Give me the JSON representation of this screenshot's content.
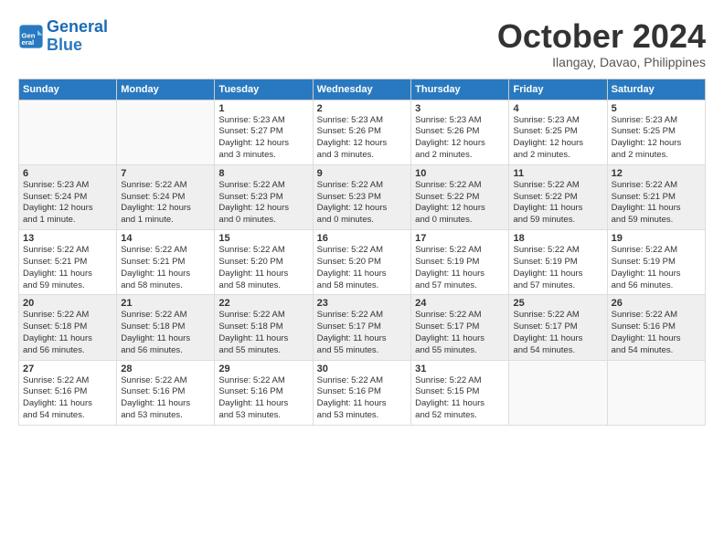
{
  "logo": {
    "text_general": "General",
    "text_blue": "Blue"
  },
  "header": {
    "month": "October 2024",
    "location": "Ilangay, Davao, Philippines"
  },
  "weekdays": [
    "Sunday",
    "Monday",
    "Tuesday",
    "Wednesday",
    "Thursday",
    "Friday",
    "Saturday"
  ],
  "weeks": [
    {
      "days": [
        {
          "num": "",
          "info": ""
        },
        {
          "num": "",
          "info": ""
        },
        {
          "num": "1",
          "info": "Sunrise: 5:23 AM\nSunset: 5:27 PM\nDaylight: 12 hours\nand 3 minutes."
        },
        {
          "num": "2",
          "info": "Sunrise: 5:23 AM\nSunset: 5:26 PM\nDaylight: 12 hours\nand 3 minutes."
        },
        {
          "num": "3",
          "info": "Sunrise: 5:23 AM\nSunset: 5:26 PM\nDaylight: 12 hours\nand 2 minutes."
        },
        {
          "num": "4",
          "info": "Sunrise: 5:23 AM\nSunset: 5:25 PM\nDaylight: 12 hours\nand 2 minutes."
        },
        {
          "num": "5",
          "info": "Sunrise: 5:23 AM\nSunset: 5:25 PM\nDaylight: 12 hours\nand 2 minutes."
        }
      ]
    },
    {
      "days": [
        {
          "num": "6",
          "info": "Sunrise: 5:23 AM\nSunset: 5:24 PM\nDaylight: 12 hours\nand 1 minute."
        },
        {
          "num": "7",
          "info": "Sunrise: 5:22 AM\nSunset: 5:24 PM\nDaylight: 12 hours\nand 1 minute."
        },
        {
          "num": "8",
          "info": "Sunrise: 5:22 AM\nSunset: 5:23 PM\nDaylight: 12 hours\nand 0 minutes."
        },
        {
          "num": "9",
          "info": "Sunrise: 5:22 AM\nSunset: 5:23 PM\nDaylight: 12 hours\nand 0 minutes."
        },
        {
          "num": "10",
          "info": "Sunrise: 5:22 AM\nSunset: 5:22 PM\nDaylight: 12 hours\nand 0 minutes."
        },
        {
          "num": "11",
          "info": "Sunrise: 5:22 AM\nSunset: 5:22 PM\nDaylight: 11 hours\nand 59 minutes."
        },
        {
          "num": "12",
          "info": "Sunrise: 5:22 AM\nSunset: 5:21 PM\nDaylight: 11 hours\nand 59 minutes."
        }
      ]
    },
    {
      "days": [
        {
          "num": "13",
          "info": "Sunrise: 5:22 AM\nSunset: 5:21 PM\nDaylight: 11 hours\nand 59 minutes."
        },
        {
          "num": "14",
          "info": "Sunrise: 5:22 AM\nSunset: 5:21 PM\nDaylight: 11 hours\nand 58 minutes."
        },
        {
          "num": "15",
          "info": "Sunrise: 5:22 AM\nSunset: 5:20 PM\nDaylight: 11 hours\nand 58 minutes."
        },
        {
          "num": "16",
          "info": "Sunrise: 5:22 AM\nSunset: 5:20 PM\nDaylight: 11 hours\nand 58 minutes."
        },
        {
          "num": "17",
          "info": "Sunrise: 5:22 AM\nSunset: 5:19 PM\nDaylight: 11 hours\nand 57 minutes."
        },
        {
          "num": "18",
          "info": "Sunrise: 5:22 AM\nSunset: 5:19 PM\nDaylight: 11 hours\nand 57 minutes."
        },
        {
          "num": "19",
          "info": "Sunrise: 5:22 AM\nSunset: 5:19 PM\nDaylight: 11 hours\nand 56 minutes."
        }
      ]
    },
    {
      "days": [
        {
          "num": "20",
          "info": "Sunrise: 5:22 AM\nSunset: 5:18 PM\nDaylight: 11 hours\nand 56 minutes."
        },
        {
          "num": "21",
          "info": "Sunrise: 5:22 AM\nSunset: 5:18 PM\nDaylight: 11 hours\nand 56 minutes."
        },
        {
          "num": "22",
          "info": "Sunrise: 5:22 AM\nSunset: 5:18 PM\nDaylight: 11 hours\nand 55 minutes."
        },
        {
          "num": "23",
          "info": "Sunrise: 5:22 AM\nSunset: 5:17 PM\nDaylight: 11 hours\nand 55 minutes."
        },
        {
          "num": "24",
          "info": "Sunrise: 5:22 AM\nSunset: 5:17 PM\nDaylight: 11 hours\nand 55 minutes."
        },
        {
          "num": "25",
          "info": "Sunrise: 5:22 AM\nSunset: 5:17 PM\nDaylight: 11 hours\nand 54 minutes."
        },
        {
          "num": "26",
          "info": "Sunrise: 5:22 AM\nSunset: 5:16 PM\nDaylight: 11 hours\nand 54 minutes."
        }
      ]
    },
    {
      "days": [
        {
          "num": "27",
          "info": "Sunrise: 5:22 AM\nSunset: 5:16 PM\nDaylight: 11 hours\nand 54 minutes."
        },
        {
          "num": "28",
          "info": "Sunrise: 5:22 AM\nSunset: 5:16 PM\nDaylight: 11 hours\nand 53 minutes."
        },
        {
          "num": "29",
          "info": "Sunrise: 5:22 AM\nSunset: 5:16 PM\nDaylight: 11 hours\nand 53 minutes."
        },
        {
          "num": "30",
          "info": "Sunrise: 5:22 AM\nSunset: 5:16 PM\nDaylight: 11 hours\nand 53 minutes."
        },
        {
          "num": "31",
          "info": "Sunrise: 5:22 AM\nSunset: 5:15 PM\nDaylight: 11 hours\nand 52 minutes."
        },
        {
          "num": "",
          "info": ""
        },
        {
          "num": "",
          "info": ""
        }
      ]
    }
  ]
}
